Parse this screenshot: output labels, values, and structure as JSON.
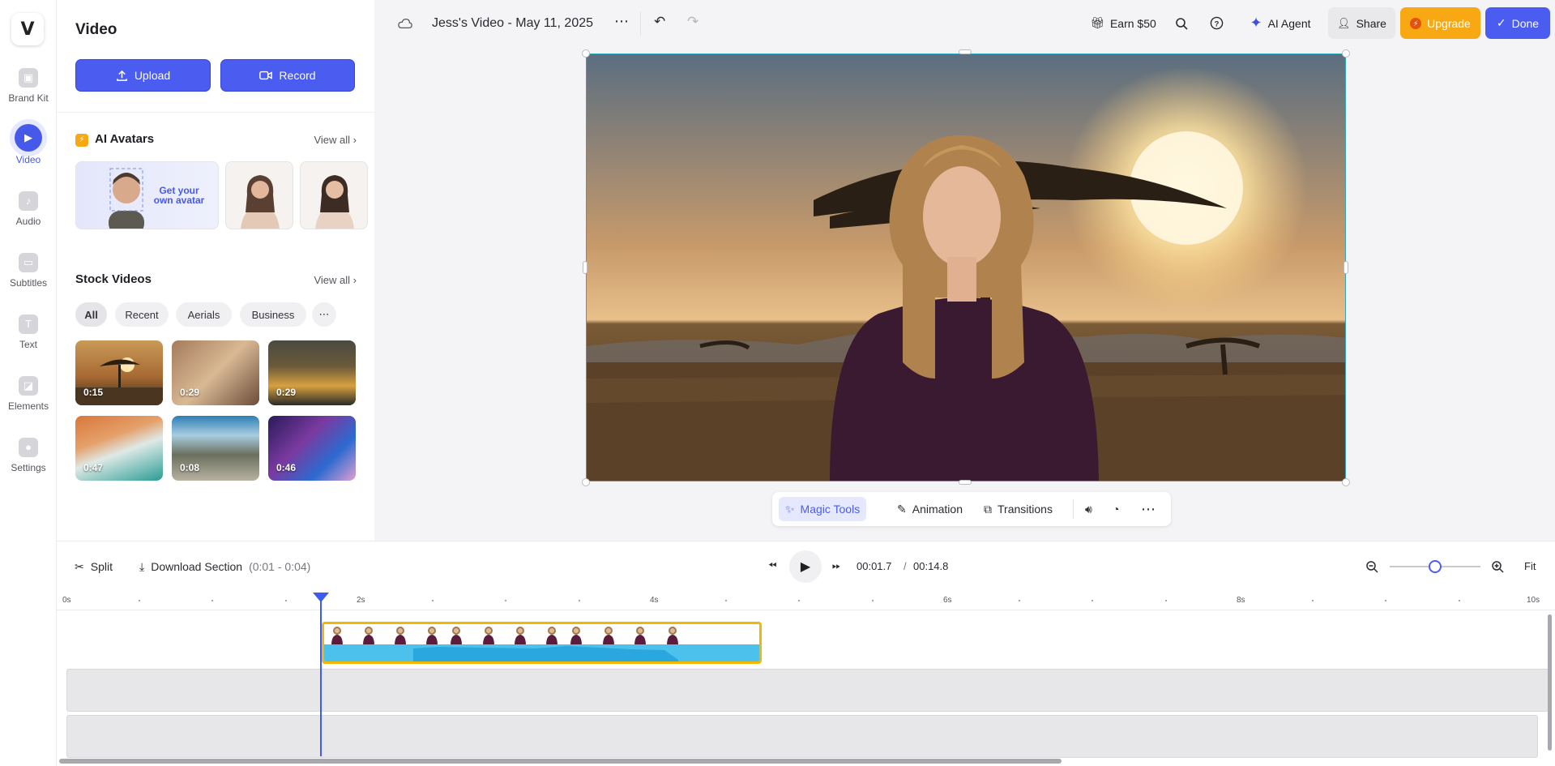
{
  "rail": {
    "logo": "V",
    "items": [
      {
        "label": "Brand Kit",
        "icon": "brand-kit-icon"
      },
      {
        "label": "Video",
        "icon": "video-icon"
      },
      {
        "label": "Audio",
        "icon": "audio-icon"
      },
      {
        "label": "Subtitles",
        "icon": "subtitles-icon"
      },
      {
        "label": "Text",
        "icon": "text-icon"
      },
      {
        "label": "Elements",
        "icon": "elements-icon"
      },
      {
        "label": "Settings",
        "icon": "settings-icon"
      }
    ]
  },
  "panel": {
    "title": "Video",
    "upload_label": "Upload",
    "record_label": "Record",
    "ai_avatars": {
      "title": "AI Avatars",
      "view_all": "View all",
      "own_avatar_text": "Get your own avatar"
    },
    "stock_videos": {
      "title": "Stock Videos",
      "view_all": "View all",
      "filters": [
        "All",
        "Recent",
        "Aerials",
        "Business"
      ],
      "thumbs": [
        {
          "duration": "0:15"
        },
        {
          "duration": "0:29"
        },
        {
          "duration": "0:29"
        },
        {
          "duration": "0:47"
        },
        {
          "duration": "0:08"
        },
        {
          "duration": "0:46"
        }
      ]
    }
  },
  "topbar": {
    "doc_title": "Jess's Video - May 11, 2025",
    "earn_label": "Earn $50",
    "ai_agent_label": "AI Agent",
    "share_label": "Share",
    "upgrade_label": "Upgrade",
    "done_label": "Done",
    "colors": {
      "upgrade": "#f7a812",
      "done": "#4a5df0"
    }
  },
  "floatbar": {
    "magic_tools_label": "Magic Tools",
    "animation_label": "Animation",
    "transitions_label": "Transitions"
  },
  "timeline": {
    "split_label": "Split",
    "download_label": "Download Section",
    "download_range": "(0:01 - 0:04)",
    "current_time": "00:01.7",
    "separator": "/",
    "total_time": "00:14.8",
    "fit_label": "Fit",
    "zoom_level": 0.5,
    "ruler_labels": [
      "0s",
      "2s",
      "4s",
      "6s",
      "8s",
      "10s"
    ]
  }
}
